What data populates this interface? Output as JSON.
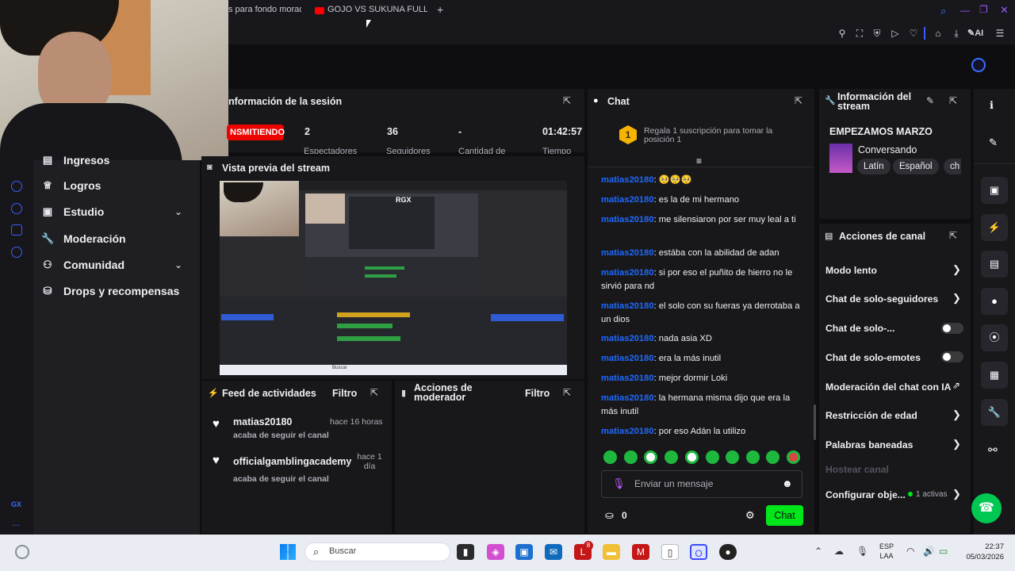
{
  "browser": {
    "tab1": "s para fondo morado",
    "tab2": "GOJO VS SUKUNA FULL F",
    "new_tab": "+",
    "ai_label": "AI"
  },
  "session": {
    "title": "nformación de la sesión",
    "live_badge": "NSMITIENDO",
    "stats": [
      {
        "value": "2",
        "label": "Espectadores"
      },
      {
        "value": "36",
        "label": "Seguidores"
      },
      {
        "value": "-",
        "label": "Cantidad de"
      },
      {
        "value": "01:42:57",
        "label": "Tiempo"
      }
    ]
  },
  "sidebar": {
    "items": [
      {
        "label": "Ingresos",
        "icon": "building-icon"
      },
      {
        "label": "Logros",
        "icon": "trophy-icon"
      },
      {
        "label": "Estudio",
        "icon": "studio-icon"
      },
      {
        "label": "Moderación",
        "icon": "wrench-icon"
      },
      {
        "label": "Comunidad",
        "icon": "people-icon"
      },
      {
        "label": "Drops y recompensas",
        "icon": "gift-icon"
      }
    ],
    "gx": "GX",
    "more": "..."
  },
  "preview": {
    "title": "Vista previa del stream",
    "rgx": "RGX",
    "search": "Buscar"
  },
  "feed": {
    "title": "Feed de actividades",
    "filter": "Filtro",
    "items": [
      {
        "user": "matias20180",
        "time": "hace 16 horas",
        "desc": "acaba de seguir el canal"
      },
      {
        "user": "officialgamblingacademy",
        "time": "hace 1\ndía",
        "desc": "acaba de seguir el canal"
      }
    ]
  },
  "mod_actions": {
    "title": "Acciones de\nmoderador",
    "filter": "Filtro"
  },
  "chat": {
    "title": "Chat",
    "gift_badge": "1",
    "gift_text": "Regala 1 suscripción para tomar la posición 1",
    "messages": [
      {
        "user": "matias20180",
        "text": ": 🥺🥺🥺"
      },
      {
        "user": "matias20180",
        "text": ": es la de mi hermano"
      },
      {
        "user": "matias20180",
        "text": ": me silensiaron por ser muy leal a ti"
      },
      {
        "user": "matias20180",
        "text": ": estába con la abilidad de adan"
      },
      {
        "user": "matias20180",
        "text": ": si por eso el puñito de hierro no le sirvió para nd"
      },
      {
        "user": "matias20180",
        "text": ": el solo con su fueras ya derrotaba a un dios"
      },
      {
        "user": "matias20180",
        "text": ": nada asia XD"
      },
      {
        "user": "matias20180",
        "text": ": era la más inutil"
      },
      {
        "user": "matias20180",
        "text": ": mejor dormir Loki"
      },
      {
        "user": "matias20180",
        "text": ": la hermana misma dijo que era la más inutil"
      },
      {
        "user": "matias20180",
        "text": ": por eso Adán la utilizo"
      }
    ],
    "input_placeholder": "Enviar un mensaje",
    "points": "0",
    "send": "Chat"
  },
  "stream_info": {
    "title": "Información del stream",
    "stream_title": "EMPEZAMOS MARZO",
    "category": "Conversando",
    "tags": [
      "Latín",
      "Español",
      "ch"
    ]
  },
  "channel_actions": {
    "title": "Acciones de canal",
    "items": [
      {
        "label": "Modo lento"
      },
      {
        "label": "Chat de solo-seguidores"
      },
      {
        "label": "Chat de solo-..."
      },
      {
        "label": "Chat de solo-emotes"
      },
      {
        "label": "Moderación del chat con IA"
      },
      {
        "label": "Restricción de edad"
      },
      {
        "label": "Palabras baneadas"
      },
      {
        "label": "Hostear canal"
      },
      {
        "label": "Configurar obje..."
      }
    ],
    "active_count": "1 activas"
  },
  "taskbar": {
    "search": "Buscar",
    "lang1": "ESP",
    "lang2": "LAA",
    "time": "22:37",
    "date": "05/03/2026",
    "badge": "8"
  },
  "colors": {
    "accent": "#1f69ff",
    "live": "#eb0400",
    "chat_button": "#00e61a",
    "panel": "#18181b",
    "background": "#0e0e10"
  }
}
